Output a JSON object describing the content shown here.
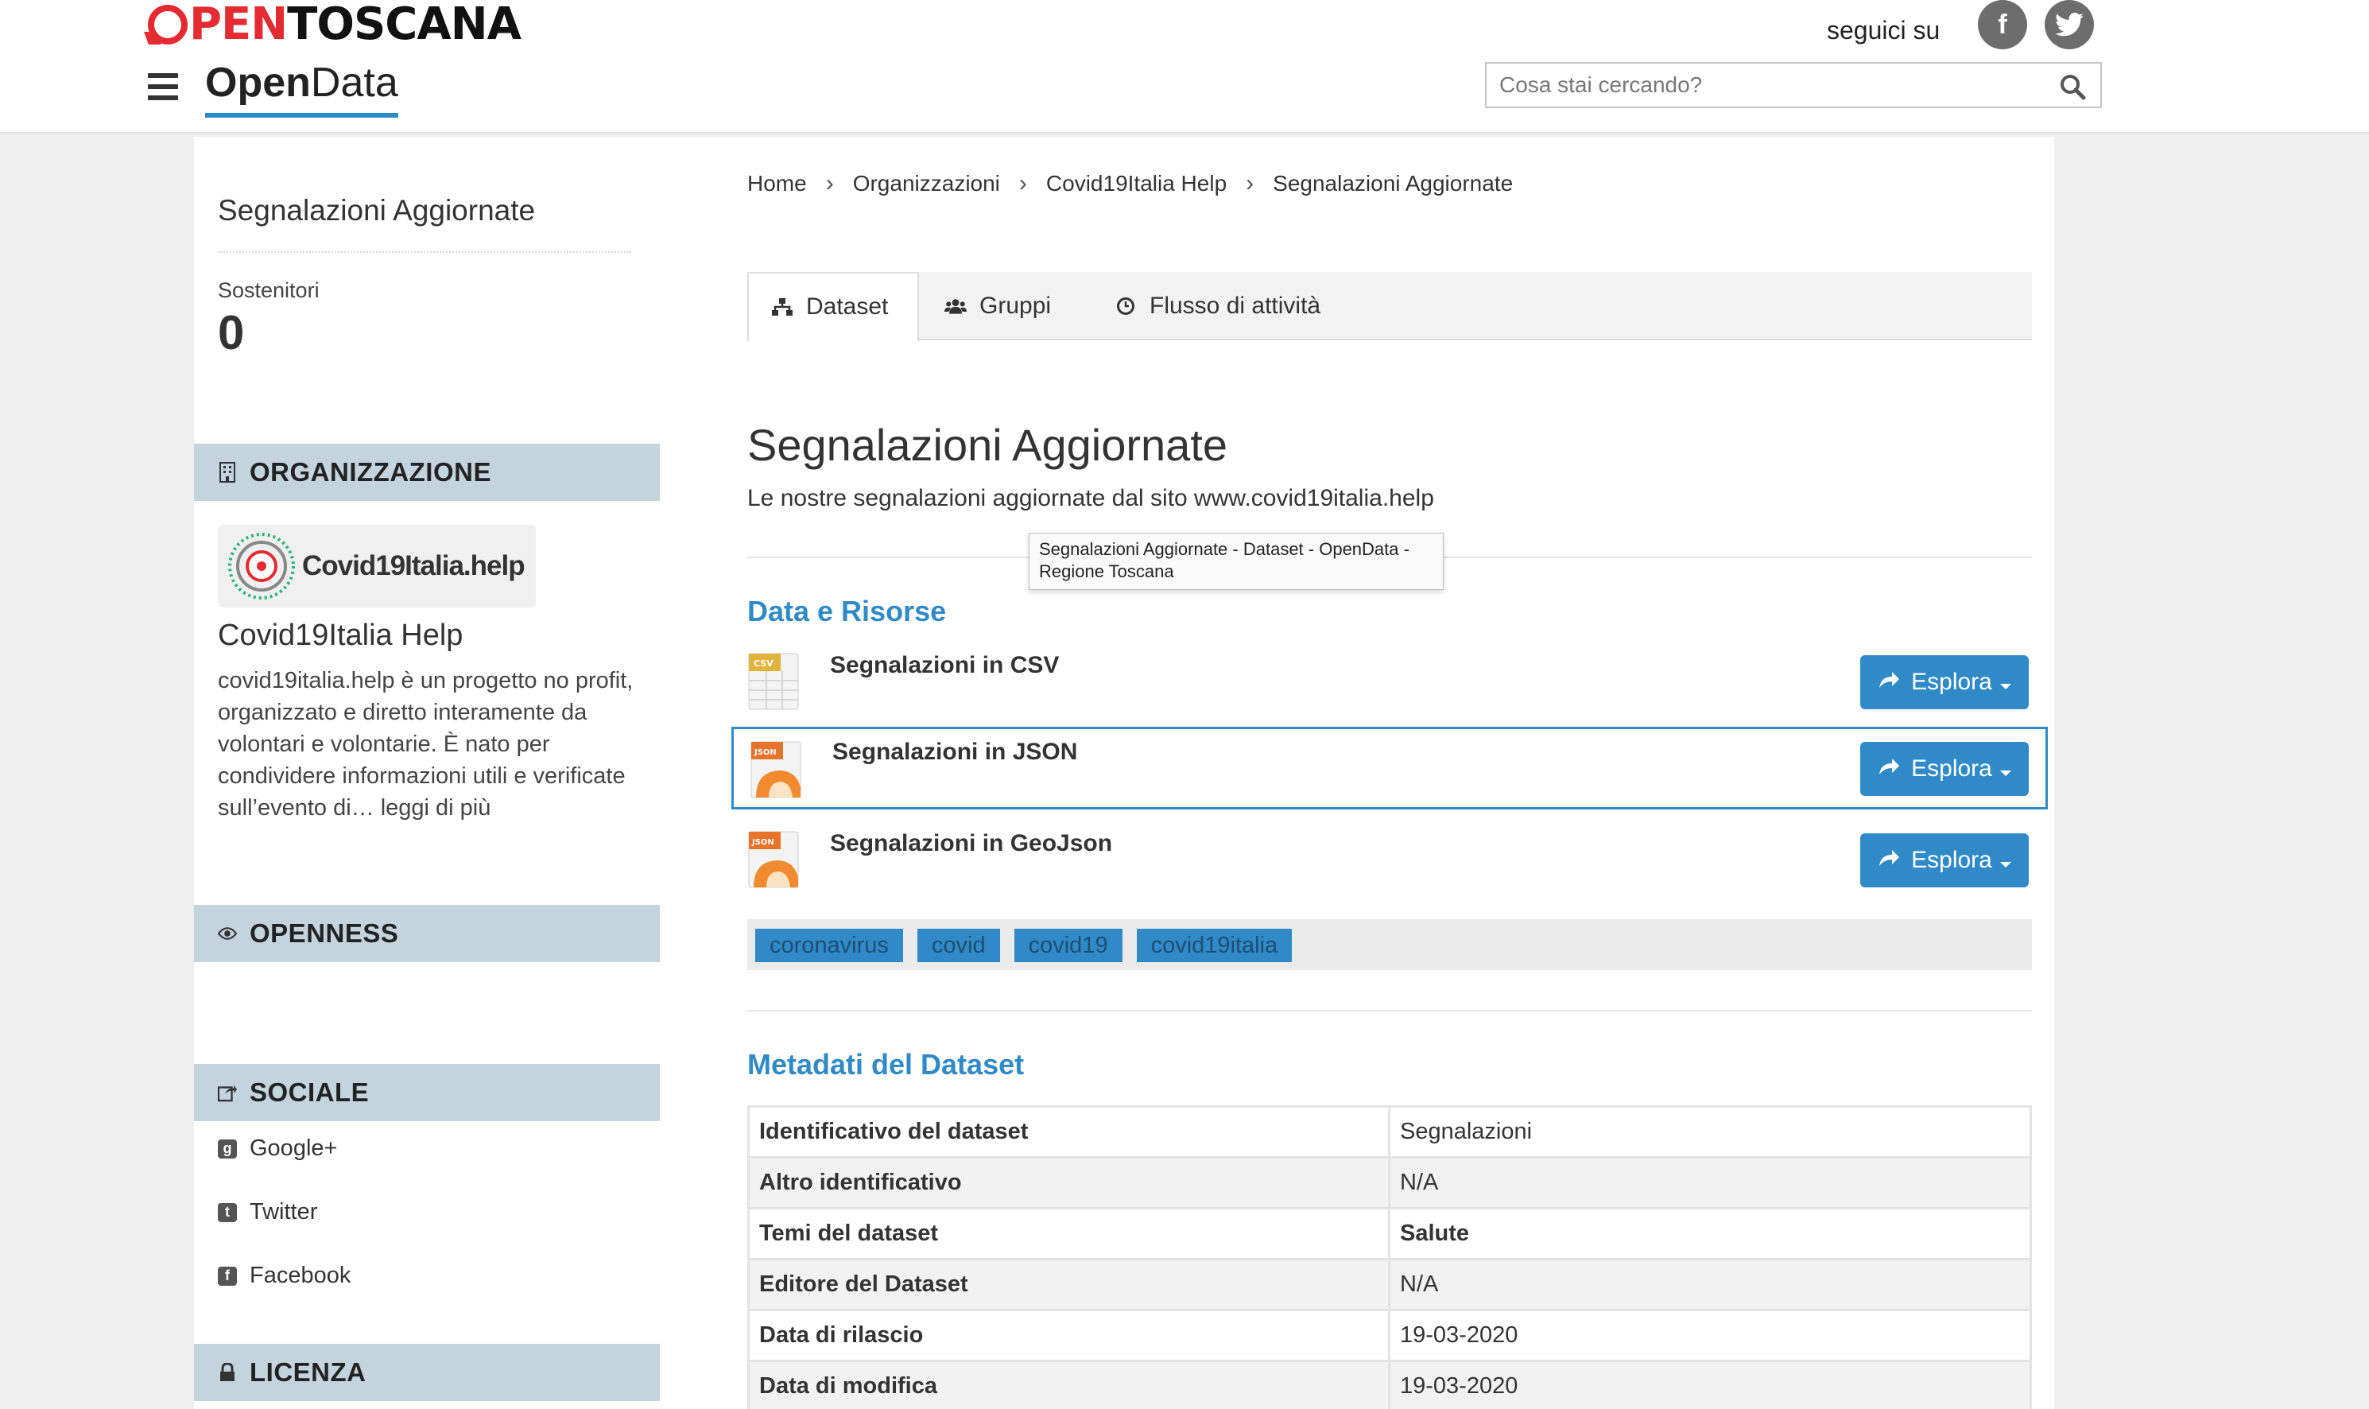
{
  "header": {
    "brand_first": "O",
    "brand_red": "PEN",
    "brand_dark": "TOSCANA",
    "opendata_bold": "Open",
    "opendata_light": "Data",
    "follow_label": "seguici su",
    "social": [
      "facebook-icon",
      "twitter-icon"
    ],
    "search_placeholder": "Cosa stai cercando?"
  },
  "sidebar": {
    "title": "Segnalazioni Aggiornate",
    "followers_label": "Sostenitori",
    "followers_count": "0",
    "org_heading": "ORGANIZZAZIONE",
    "org_logo_text": "Covid19Italia.help",
    "org_name": "Covid19Italia Help",
    "org_description": "covid19italia.help è un progetto no profit, organizzato e diretto interamente da volontari e volontarie. È nato per condividere informazioni utili e verificate sull’evento di…",
    "org_more": "leggi di più",
    "openness_heading": "OPENNESS",
    "social_heading": "SOCIALE",
    "social_items": [
      "Google+",
      "Twitter",
      "Facebook"
    ],
    "license_heading": "LICENZA"
  },
  "breadcrumb": [
    "Home",
    "Organizzazioni",
    "Covid19Italia Help",
    "Segnalazioni Aggiornate"
  ],
  "tabs": [
    "Dataset",
    "Gruppi",
    "Flusso di attività"
  ],
  "dataset": {
    "title": "Segnalazioni Aggiornate",
    "description": "Le nostre segnalazioni aggiornate dal sito www.covid19italia.help",
    "tooltip": "Segnalazioni Aggiornate - Dataset - OpenData - Regione Toscana"
  },
  "resources_title": "Data e Risorse",
  "resources": [
    {
      "name": "Segnalazioni in CSV",
      "format": "CSV",
      "action": "Esplora"
    },
    {
      "name": "Segnalazioni in JSON",
      "format": "JSON",
      "action": "Esplora"
    },
    {
      "name": "Segnalazioni in GeoJson",
      "format": "JSON",
      "action": "Esplora"
    }
  ],
  "tags": [
    "coronavirus",
    "covid",
    "covid19",
    "covid19italia"
  ],
  "metadata_title": "Metadati del Dataset",
  "metadata": [
    {
      "key": "Identificativo del dataset",
      "value": "Segnalazioni"
    },
    {
      "key": "Altro identificativo",
      "value": "N/A"
    },
    {
      "key": "Temi del dataset",
      "value": "Salute"
    },
    {
      "key": "Editore del Dataset",
      "value": "N/A"
    },
    {
      "key": "Data di rilascio",
      "value": "19-03-2020"
    },
    {
      "key": "Data di modifica",
      "value": "19-03-2020"
    }
  ],
  "colors": {
    "accent": "#2f8ac7",
    "brand_red": "#e42b32",
    "sidebar_head": "#c4d4df"
  }
}
